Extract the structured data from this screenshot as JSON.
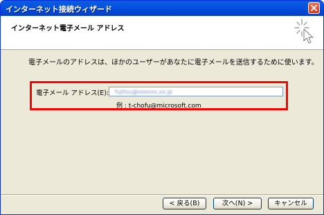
{
  "window": {
    "title": "インターネット接続ウィザード"
  },
  "header": {
    "title": "インターネット電子メール アドレス"
  },
  "main": {
    "instruction": "電子メールのアドレスは、ほかのユーザーがあなたに電子メールを送信するために使います。",
    "email_label": "電子メール アドレス(E):",
    "email_value": "fujitsu@xxxxxx.xx.jp",
    "example": "例 : t-chofu@microsoft.com"
  },
  "buttons": {
    "back": "< 戻る(B)",
    "next": "次へ(N) >",
    "cancel": "キャンセル"
  },
  "colors": {
    "titlebar": "#0a5ee0",
    "dialog_bg": "#ece9d8",
    "highlight": "#ff0000"
  }
}
